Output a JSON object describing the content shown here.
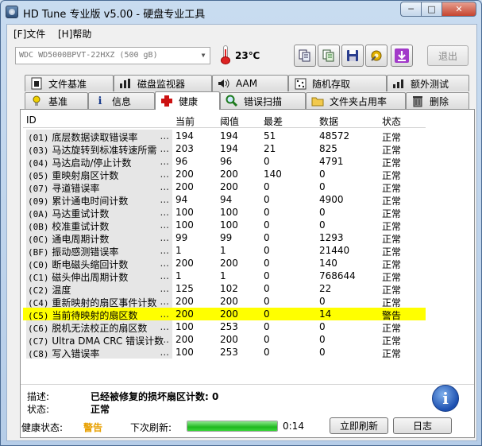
{
  "window": {
    "title": "HD Tune 专业版 v5.00 - 硬盘专业工具"
  },
  "menu": {
    "file": "[F]文件",
    "help": "[H]帮助"
  },
  "toolbar": {
    "drive": "WDC WD5000BPVT-22HXZ        (500 gB)",
    "temperature": "23℃",
    "exit_label": "退出",
    "buttons": [
      "copy-icon",
      "copy-all-icon",
      "save-icon",
      "options-icon",
      "download-icon"
    ]
  },
  "tabs_top": [
    {
      "label": "文件基准",
      "icon": "file-benchmark-icon"
    },
    {
      "label": "磁盘监视器",
      "icon": "disk-monitor-icon"
    },
    {
      "label": "AAM",
      "icon": "speaker-icon"
    },
    {
      "label": "随机存取",
      "icon": "random-access-icon"
    },
    {
      "label": "额外测试",
      "icon": "extra-tests-icon"
    }
  ],
  "tabs_bottom": [
    {
      "label": "基准",
      "icon": "benchmark-icon"
    },
    {
      "label": "信息",
      "icon": "info-icon"
    },
    {
      "label": "健康",
      "icon": "health-cross-icon",
      "active": true
    },
    {
      "label": "错误扫描",
      "icon": "magnifier-icon"
    },
    {
      "label": "文件夹占用率",
      "icon": "folder-icon"
    },
    {
      "label": "删除",
      "icon": "trash-icon"
    }
  ],
  "table": {
    "headers": {
      "id": "ID",
      "current": "当前",
      "threshold": "阈值",
      "worst": "最差",
      "data": "数据",
      "status": "状态"
    },
    "rows": [
      {
        "code": "(01)",
        "name": "底层数据读取错误率",
        "current": "194",
        "threshold": "194",
        "worst": "51",
        "data": "48572",
        "status": "正常"
      },
      {
        "code": "(03)",
        "name": "马达旋转到标准转速所需",
        "current": "203",
        "threshold": "194",
        "worst": "21",
        "data": "825",
        "status": "正常"
      },
      {
        "code": "(04)",
        "name": "马达启动/停止计数",
        "current": "96",
        "threshold": "96",
        "worst": "0",
        "data": "4791",
        "status": "正常"
      },
      {
        "code": "(05)",
        "name": "重映射扇区计数",
        "current": "200",
        "threshold": "200",
        "worst": "140",
        "data": "0",
        "status": "正常"
      },
      {
        "code": "(07)",
        "name": "寻道错误率",
        "current": "200",
        "threshold": "200",
        "worst": "0",
        "data": "0",
        "status": "正常"
      },
      {
        "code": "(09)",
        "name": "累计通电时间计数",
        "current": "94",
        "threshold": "94",
        "worst": "0",
        "data": "4900",
        "status": "正常"
      },
      {
        "code": "(0A)",
        "name": "马达重试计数",
        "current": "100",
        "threshold": "100",
        "worst": "0",
        "data": "0",
        "status": "正常"
      },
      {
        "code": "(0B)",
        "name": "校准重试计数",
        "current": "100",
        "threshold": "100",
        "worst": "0",
        "data": "0",
        "status": "正常"
      },
      {
        "code": "(0C)",
        "name": "通电周期计数",
        "current": "99",
        "threshold": "99",
        "worst": "0",
        "data": "1293",
        "status": "正常"
      },
      {
        "code": "(BF)",
        "name": "振动感测错误率",
        "current": "1",
        "threshold": "1",
        "worst": "0",
        "data": "21440",
        "status": "正常"
      },
      {
        "code": "(C0)",
        "name": "断电磁头缩回计数",
        "current": "200",
        "threshold": "200",
        "worst": "0",
        "data": "140",
        "status": "正常"
      },
      {
        "code": "(C1)",
        "name": "磁头伸出周期计数",
        "current": "1",
        "threshold": "1",
        "worst": "0",
        "data": "768644",
        "status": "正常"
      },
      {
        "code": "(C2)",
        "name": "温度",
        "current": "125",
        "threshold": "102",
        "worst": "0",
        "data": "22",
        "status": "正常"
      },
      {
        "code": "(C4)",
        "name": "重新映射的扇区事件计数",
        "current": "200",
        "threshold": "200",
        "worst": "0",
        "data": "0",
        "status": "正常"
      },
      {
        "code": "(C5)",
        "name": "当前待映射的扇区数",
        "current": "200",
        "threshold": "200",
        "worst": "0",
        "data": "14",
        "status": "警告",
        "highlight": true
      },
      {
        "code": "(C6)",
        "name": "脱机无法校正的扇区数",
        "current": "100",
        "threshold": "253",
        "worst": "0",
        "data": "0",
        "status": "正常"
      },
      {
        "code": "(C7)",
        "name": "Ultra DMA CRC 错误计数",
        "current": "200",
        "threshold": "200",
        "worst": "0",
        "data": "0",
        "status": "正常"
      },
      {
        "code": "(C8)",
        "name": "写入错误率",
        "current": "100",
        "threshold": "253",
        "worst": "0",
        "data": "0",
        "status": "正常"
      }
    ],
    "ellipsis": "..."
  },
  "details": {
    "description_label": "描述:",
    "description_value": "已经被修复的损坏扇区计数: 0",
    "state_label": "状态:",
    "state_value": "正常"
  },
  "statusbar": {
    "health_label": "健康状态:",
    "health_value": "警告",
    "next_refresh_label": "下次刷新:",
    "refresh_progress": 1.0,
    "countdown": "0:14",
    "refresh_button": "立即刷新",
    "log_button": "日志"
  },
  "colors": {
    "highlight": "#ffff00",
    "warning_text": "#e8a000",
    "progress": "#1fb81f",
    "health_cross": "#cc1111"
  }
}
